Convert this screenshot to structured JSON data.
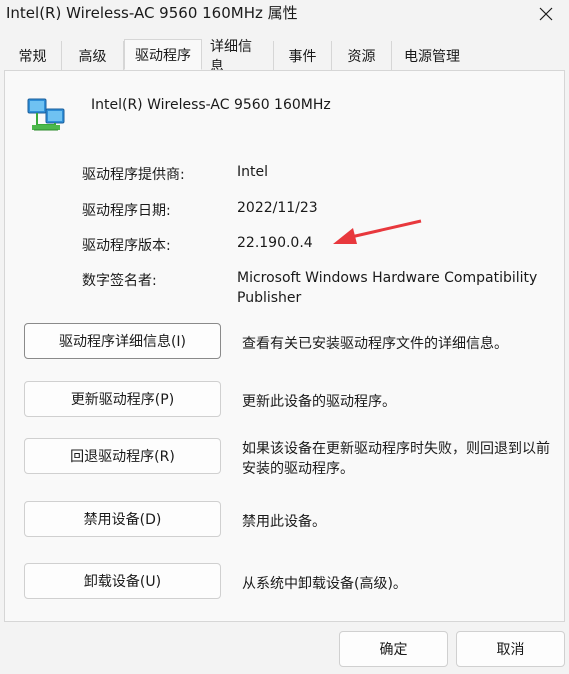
{
  "window": {
    "title": "Intel(R) Wireless-AC 9560 160MHz 属性"
  },
  "tabs": [
    {
      "label": "常规"
    },
    {
      "label": "高级"
    },
    {
      "label": "驱动程序"
    },
    {
      "label": "详细信息"
    },
    {
      "label": "事件"
    },
    {
      "label": "资源"
    },
    {
      "label": "电源管理"
    }
  ],
  "active_tab": "驱动程序",
  "device": {
    "name": "Intel(R) Wireless-AC 9560 160MHz",
    "icon": "network-adapter-icon"
  },
  "properties": [
    {
      "label": "驱动程序提供商:",
      "value": "Intel"
    },
    {
      "label": "驱动程序日期:",
      "value": "2022/11/23"
    },
    {
      "label": "驱动程序版本:",
      "value": "22.190.0.4"
    },
    {
      "label": "数字签名者:",
      "value": "Microsoft Windows Hardware Compatibility Publisher"
    }
  ],
  "annotation": {
    "color": "#e8383d",
    "icon": "red-arrow-icon"
  },
  "actions": [
    {
      "label": "驱动程序详细信息(I)",
      "desc": "查看有关已安装驱动程序文件的详细信息。"
    },
    {
      "label": "更新驱动程序(P)",
      "desc": "更新此设备的驱动程序。"
    },
    {
      "label": "回退驱动程序(R)",
      "desc": "如果该设备在更新驱动程序时失败，则回退到以前安装的驱动程序。"
    },
    {
      "label": "禁用设备(D)",
      "desc": "禁用此设备。"
    },
    {
      "label": "卸载设备(U)",
      "desc": "从系统中卸载设备(高级)。"
    }
  ],
  "footer": {
    "ok_label": "确定",
    "cancel_label": "取消"
  }
}
